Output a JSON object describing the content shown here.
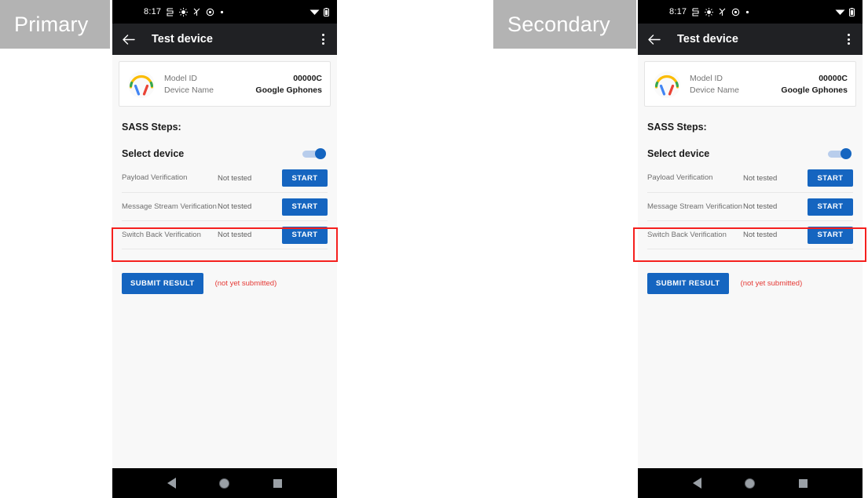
{
  "labels": {
    "primary": "Primary",
    "secondary": "Secondary"
  },
  "colors": {
    "accent_blue": "#1565C0",
    "highlight_red": "#F5201E",
    "note_red": "#E53935",
    "label_grey": "#B3B3B3",
    "appbar_dark": "#202124",
    "page_bg": "#F8F8F8"
  },
  "phone": {
    "status_bar": {
      "time": "8:17",
      "icons": [
        "sim-icon",
        "brightness-icon",
        "bluetooth-scan-icon",
        "settings-gear-icon",
        "dot-icon"
      ],
      "right_icons": [
        "wifi-icon",
        "battery-icon"
      ]
    },
    "app_bar": {
      "back_icon": "back-arrow-icon",
      "title": "Test device",
      "overflow_icon": "overflow-menu-icon"
    },
    "device_card": {
      "icon": "headphones-icon",
      "rows": [
        {
          "key": "Model ID",
          "value": "00000C"
        },
        {
          "key": "Device Name",
          "value": "Google Gphones"
        }
      ]
    },
    "section_title": "SASS Steps:",
    "select_device": {
      "label": "Select device",
      "toggle_on": true
    },
    "steps": [
      {
        "name": "Payload Verification",
        "status": "Not tested",
        "action": "START"
      },
      {
        "name": "Message Stream Verification",
        "status": "Not tested",
        "action": "START"
      },
      {
        "name": "Switch Back Verification",
        "status": "Not tested",
        "action": "START"
      }
    ],
    "submit": {
      "button": "SUBMIT RESULT",
      "note": "(not yet submitted)"
    },
    "nav_bar": {
      "back": "nav-back-icon",
      "home": "nav-home-icon",
      "recents": "nav-recents-icon"
    }
  }
}
